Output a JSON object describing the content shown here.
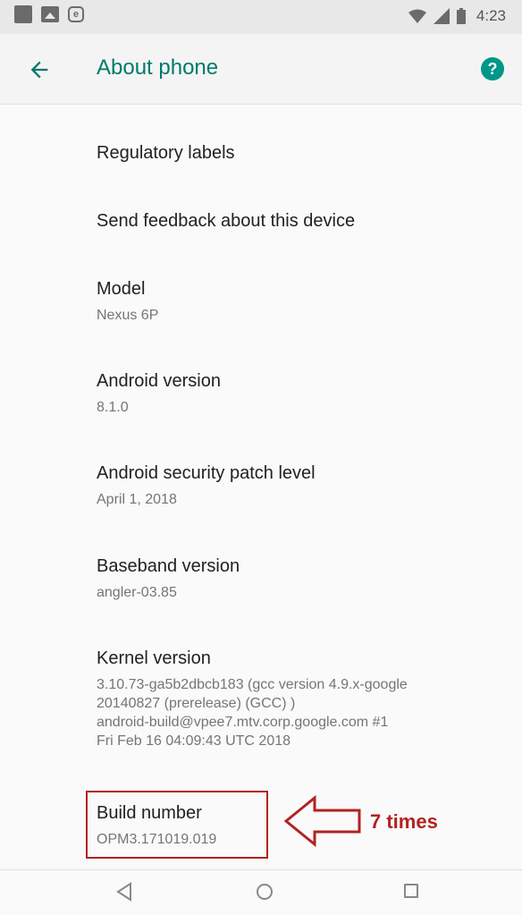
{
  "status_bar": {
    "time": "4:23",
    "icons": [
      "notification-square-icon",
      "image-icon",
      "e-icon",
      "wifi-icon",
      "signal-icon",
      "battery-icon"
    ]
  },
  "app_bar": {
    "title": "About phone",
    "back_icon": "arrow-back-icon",
    "help_icon": "help-icon",
    "help_glyph": "?",
    "accent_color": "#00796b"
  },
  "items": [
    {
      "title": "Regulatory labels"
    },
    {
      "title": "Send feedback about this device"
    },
    {
      "title": "Model",
      "subtitle": "Nexus 6P"
    },
    {
      "title": "Android version",
      "subtitle": "8.1.0"
    },
    {
      "title": "Android security patch level",
      "subtitle": "April 1, 2018"
    },
    {
      "title": "Baseband version",
      "subtitle": "angler-03.85"
    },
    {
      "title": "Kernel version",
      "subtitle_lines": [
        "3.10.73-ga5b2dbcb183 (gcc version 4.9.x-google",
        "20140827 (prerelease) (GCC) )",
        "android-build@vpee7.mtv.corp.google.com #1",
        "Fri Feb 16 04:09:43 UTC 2018"
      ]
    },
    {
      "title": "Build number",
      "subtitle": "OPM3.171019.019"
    }
  ],
  "annotation": {
    "text": "7 times",
    "color": "#b22222"
  },
  "nav_bar": {
    "icons": [
      "nav-back-icon",
      "nav-home-icon",
      "nav-recents-icon"
    ]
  }
}
